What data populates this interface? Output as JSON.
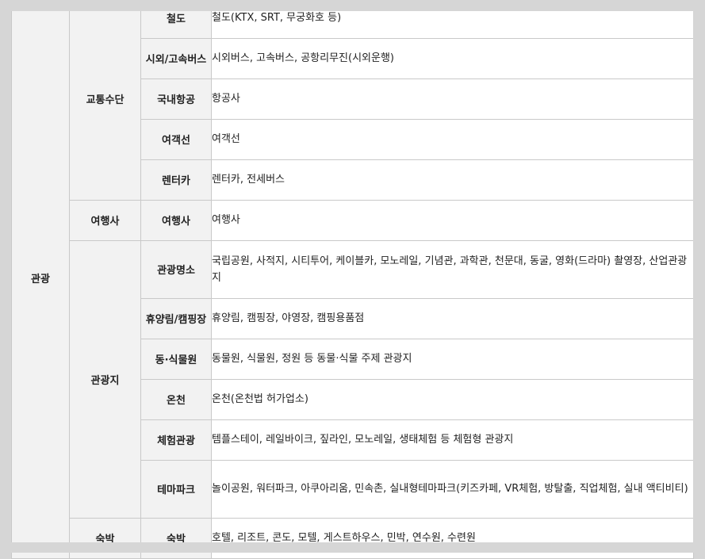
{
  "table": {
    "col1": "관광",
    "groups": {
      "transport": "교통수단",
      "travel_agency": "여행사",
      "attractions": "관광지",
      "lodging": "숙박"
    },
    "rows": [
      {
        "sub": "철도",
        "desc": "철도(KTX, SRT, 무궁화호 등)"
      },
      {
        "sub": "시외/고속버스",
        "desc": "시외버스, 고속버스, 공항리무진(시외운행)"
      },
      {
        "sub": "국내항공",
        "desc": "항공사"
      },
      {
        "sub": "여객선",
        "desc": "여객선"
      },
      {
        "sub": "렌터카",
        "desc": "렌터카, 전세버스"
      },
      {
        "sub": "여행사",
        "desc": "여행사"
      },
      {
        "sub": "관광명소",
        "desc": "국립공원, 사적지, 시티투어, 케이블카, 모노레일, 기념관, 과학관, 천문대, 동굴, 영화(드라마) 촬영장, 산업관광지"
      },
      {
        "sub": "휴양림/캠핑장",
        "desc": "휴양림, 캠핑장, 야영장, 캠핑용품점"
      },
      {
        "sub": "동·식물원",
        "desc": "동물원, 식물원, 정원 등 동물·식물 주제 관광지"
      },
      {
        "sub": "온천",
        "desc": "온천(온천법 허가업소)"
      },
      {
        "sub": "체험관광",
        "desc": "템플스테이, 레일바이크, 짚라인, 모노레일, 생태체험 등 체험형 관광지"
      },
      {
        "sub": "테마파크",
        "desc": "놀이공원, 워터파크, 아쿠아리움, 민속촌, 실내형테마파크(키즈카페, VR체험, 방탈출, 직업체험, 실내 액티비티)"
      },
      {
        "sub": "숙박",
        "desc": "호텔, 리조트, 콘도, 모텔, 게스트하우스, 민박, 연수원, 수련원"
      }
    ]
  }
}
